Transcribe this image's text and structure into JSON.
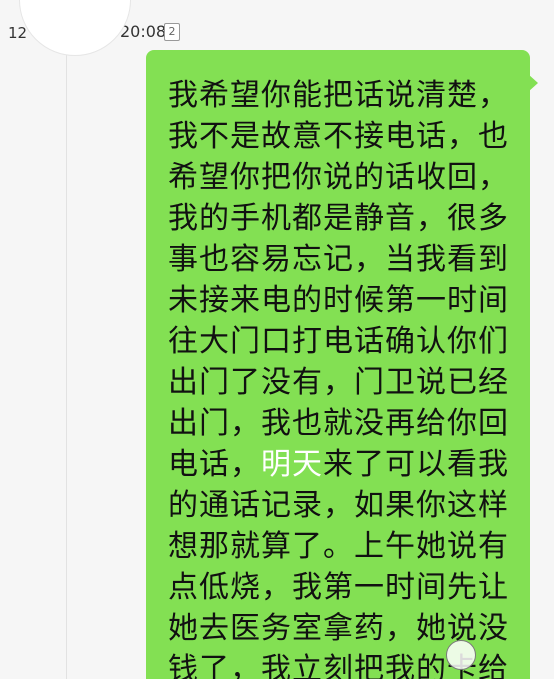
{
  "conversation": {
    "timestamp_left": "12",
    "timestamp_right": "20:08",
    "message_count_badge": "2"
  },
  "message": {
    "lines": [
      "我希望你能把话说清楚，",
      "我不是故意不接电话，也",
      "希望你把你说的话收回，",
      "我的手机都是静音，很多",
      "事也容易忘记，当我看到",
      "未接来电的时候第一时间",
      "往大门口打电话确认你们",
      "出门了没有，门卫说已经",
      "出门，我也就没再给你回",
      "电话，",
      "的通话记录，如果你这样",
      "想那就算了。上午她说有",
      "点低烧，我第一时间先让",
      "她去医务室拿药，她说没",
      "钱了，我立刻把我的卡给"
    ],
    "link_word": "明天",
    "link_line_suffix": "来了可以看我"
  },
  "bubble_color": "#83e053",
  "avatar_icon": "default-user-avatar-icon"
}
